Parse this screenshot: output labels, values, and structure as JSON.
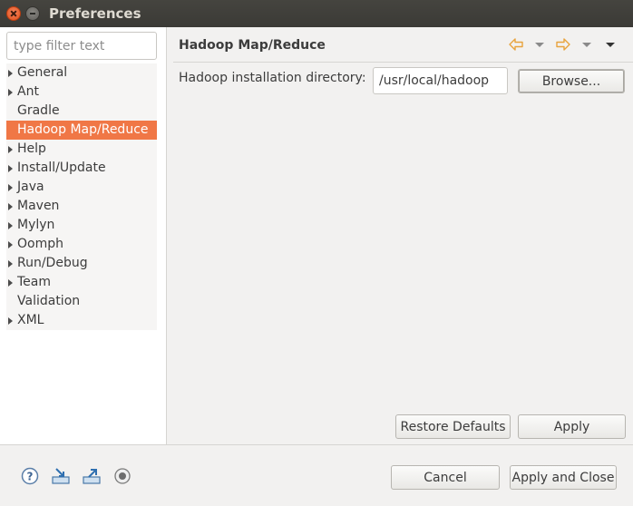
{
  "window": {
    "title": "Preferences"
  },
  "sidebar": {
    "filter_placeholder": "type filter text",
    "items": [
      {
        "label": "General",
        "expandable": true
      },
      {
        "label": "Ant",
        "expandable": true
      },
      {
        "label": "Gradle",
        "expandable": false
      },
      {
        "label": "Hadoop Map/Reduce",
        "expandable": false,
        "selected": true
      },
      {
        "label": "Help",
        "expandable": true
      },
      {
        "label": "Install/Update",
        "expandable": true
      },
      {
        "label": "Java",
        "expandable": true
      },
      {
        "label": "Maven",
        "expandable": true
      },
      {
        "label": "Mylyn",
        "expandable": true
      },
      {
        "label": "Oomph",
        "expandable": true
      },
      {
        "label": "Run/Debug",
        "expandable": true
      },
      {
        "label": "Team",
        "expandable": true
      },
      {
        "label": "Validation",
        "expandable": false
      },
      {
        "label": "XML",
        "expandable": true
      }
    ]
  },
  "page": {
    "title": "Hadoop Map/Reduce",
    "dir_label": "Hadoop installation directory:",
    "dir_value": "/usr/local/hadoop",
    "browse_label": "Browse...",
    "restore_label": "Restore Defaults",
    "apply_label": "Apply"
  },
  "footer": {
    "cancel_label": "Cancel",
    "apply_close_label": "Apply and Close",
    "icons": [
      "help-icon",
      "import-icon",
      "export-icon",
      "record-icon"
    ]
  },
  "colors": {
    "selection": "#f07746",
    "nav_arrow": "#e8a33d",
    "titlebar": "#3c3b37"
  }
}
